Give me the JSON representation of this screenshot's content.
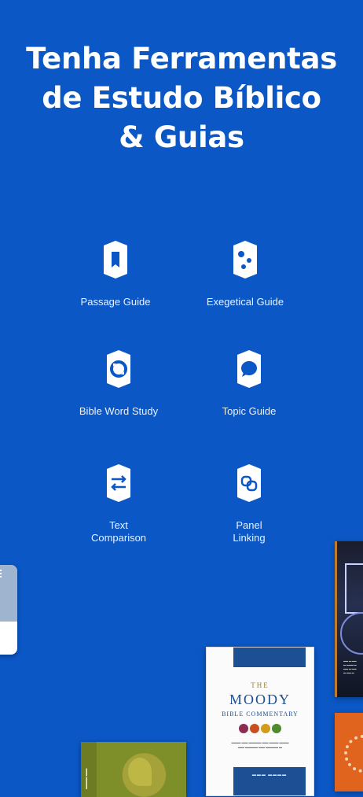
{
  "headline": {
    "line1": "Tenha Ferramentas",
    "line2": "de Estudo Bíblico",
    "line3": "& Guias"
  },
  "tools": [
    {
      "label_lines": [
        "Passage Guide"
      ],
      "icon": "bookmark-icon"
    },
    {
      "label_lines": [
        "Exegetical Guide"
      ],
      "icon": "dots-icon"
    },
    {
      "label_lines": [
        "Bible Word Study"
      ],
      "icon": "circle-arrows-icon"
    },
    {
      "label_lines": [
        "Topic Guide"
      ],
      "icon": "speech-bubble-icon"
    },
    {
      "label_lines": [
        "Text",
        "Comparison"
      ],
      "icon": "swap-arrows-icon"
    },
    {
      "label_lines": [
        "Panel",
        "Linking"
      ],
      "icon": "link-icon"
    }
  ],
  "book_cover": {
    "the": "THE",
    "title": "MOODY",
    "subtitle": "BIBLE COMMENTARY"
  },
  "colors": {
    "background": "#0a57c5",
    "badge": "#ffffff",
    "badge_glyph": "#0a57c5"
  }
}
